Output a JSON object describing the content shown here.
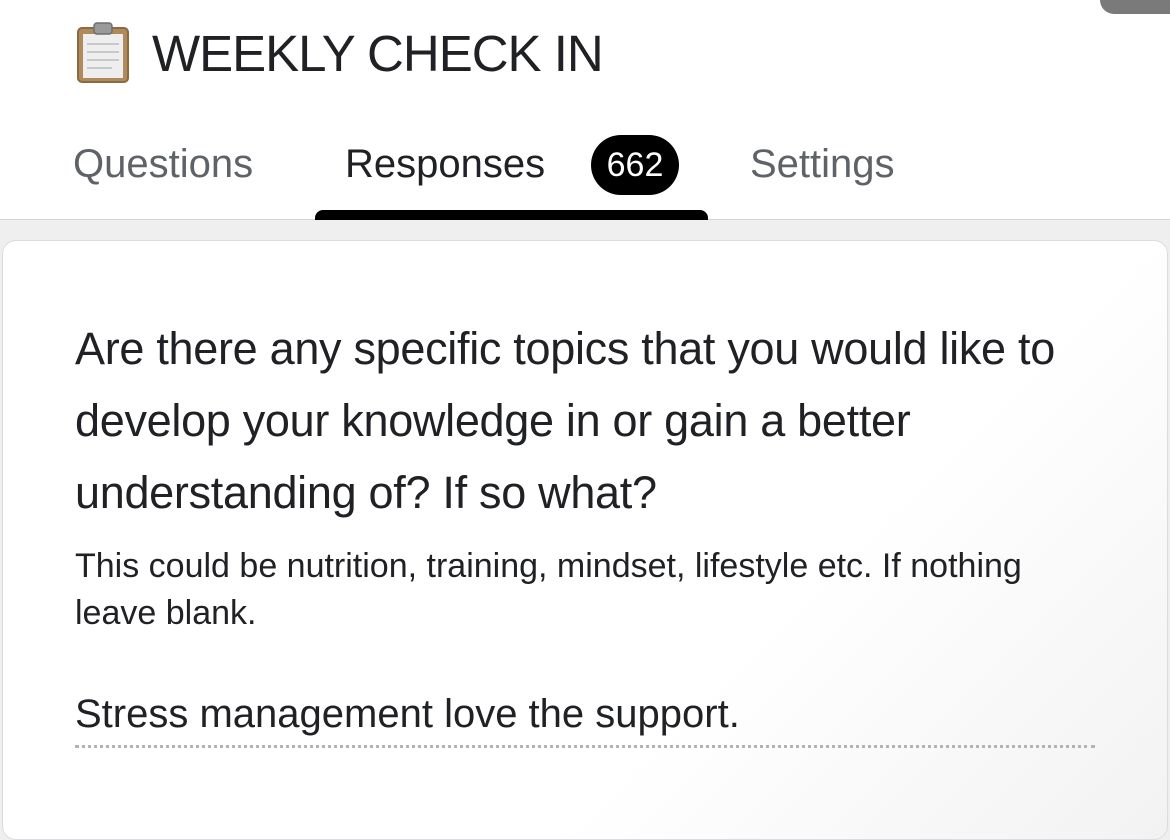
{
  "form": {
    "title": "WEEKLY CHECK IN",
    "icon": "clipboard-icon"
  },
  "tabs": [
    {
      "label": "Questions",
      "active": false
    },
    {
      "label": "Responses",
      "active": true,
      "count": "662"
    },
    {
      "label": "Settings",
      "active": false
    }
  ],
  "response": {
    "question": "Are there any specific topics that you would like to develop your knowledge in or gain a better understanding of? If so what?",
    "description": "This could be nutrition, training, mindset, lifestyle etc. If nothing leave blank.",
    "answer": "Stress management love the support."
  },
  "colors": {
    "tab_indicator": "#000000",
    "badge_background": "#000000",
    "badge_text": "#ffffff",
    "inactive_tab": "#5f6368"
  }
}
